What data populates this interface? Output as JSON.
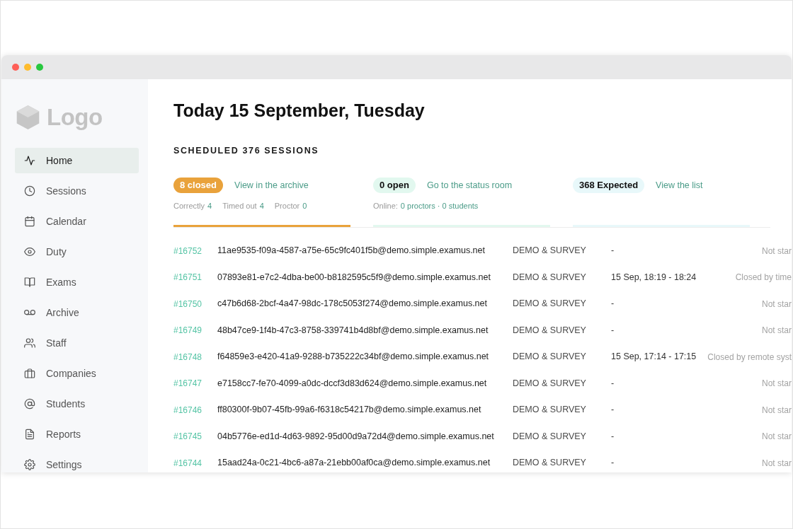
{
  "sidebar": {
    "logo": "Logo",
    "items": [
      {
        "label": "Home",
        "selected": true
      },
      {
        "label": "Sessions",
        "selected": false
      },
      {
        "label": "Calendar",
        "selected": false
      },
      {
        "label": "Duty",
        "selected": false
      },
      {
        "label": "Exams",
        "selected": false
      },
      {
        "label": "Archive",
        "selected": false
      },
      {
        "label": "Staff",
        "selected": false
      },
      {
        "label": "Companies",
        "selected": false
      },
      {
        "label": "Students",
        "selected": false
      },
      {
        "label": "Reports",
        "selected": false
      },
      {
        "label": "Settings",
        "selected": false
      }
    ]
  },
  "heading": "Today 15 September, Tuesday",
  "subheading": "SCHEDULED 376 SESSIONS",
  "summary": [
    {
      "badge": "8 closed",
      "color": "#e9a23b",
      "link": "View in the archive",
      "details": [
        {
          "label": "Correctly",
          "value": "4"
        },
        {
          "label": "Timed out",
          "value": "4"
        },
        {
          "label": "Proctor",
          "value": "0"
        }
      ]
    },
    {
      "badge": "0 open",
      "color": "#e2f8ef",
      "link": "Go to the status room",
      "details": [
        {
          "label": "Online:",
          "value": "0 proctors · 0 students"
        }
      ]
    },
    {
      "badge": "368 Expected",
      "color": "#e8f8fa",
      "link": "View the list"
    }
  ],
  "sessions": {
    "rows": [
      {
        "column_1": "#16752",
        "column_2": "11ae9535-f09a-4587-a75e-65c9fc401f5b@demo.simple.examus.net",
        "column_3": "DEMO & SURVEY",
        "column_4": "-",
        "column_5": "Not star"
      },
      {
        "column_1": "#16751",
        "column_2": "07893e81-e7c2-4dba-be00-b8182595c5f9@demo.simple.examus.net",
        "column_3": "DEMO & SURVEY",
        "column_4": "15 Sep, 18:19 - 18:24",
        "column_5": "Closed by time"
      },
      {
        "column_1": "#16750",
        "column_2": "c47b6d68-2bcf-4a47-98dc-178c5053f274@demo.simple.examus.net",
        "column_3": "DEMO & SURVEY",
        "column_4": "-",
        "column_5": "Not star"
      },
      {
        "column_1": "#16749",
        "column_2": "48b47ce9-1f4b-47c3-8758-339741b4d8bf@demo.simple.examus.net",
        "column_3": "DEMO & SURVEY",
        "column_4": "-",
        "column_5": "Not star"
      },
      {
        "column_1": "#16748",
        "column_2": "f64859e3-e420-41a9-9288-b735222c34bf@demo.simple.examus.net",
        "column_3": "DEMO & SURVEY",
        "column_4": "15 Sep, 17:14 - 17:15",
        "column_5": "Closed by remote syst"
      },
      {
        "column_1": "#16747",
        "column_2": "e7158cc7-fe70-4099-a0dc-dccf3d83d624@demo.simple.examus.net",
        "column_3": "DEMO & SURVEY",
        "column_4": "-",
        "column_5": "Not star"
      },
      {
        "column_1": "#16746",
        "column_2": "ff80300f-9b07-45fb-99a6-f6318c54217b@demo.simple.examus.net",
        "column_3": "DEMO & SURVEY",
        "column_4": "-",
        "column_5": "Not star"
      },
      {
        "column_1": "#16745",
        "column_2": "04b5776e-ed1d-4d63-9892-95d00d9a72d4@demo.simple.examus.net",
        "column_3": "DEMO & SURVEY",
        "column_4": "-",
        "column_5": "Not star"
      },
      {
        "column_1": "#16744",
        "column_2": "15aad24a-0c21-4bc6-a87a-21ebb00af0ca@demo.simple.examus.net",
        "column_3": "DEMO & SURVEY",
        "column_4": "-",
        "column_5": "Not star"
      }
    ]
  }
}
